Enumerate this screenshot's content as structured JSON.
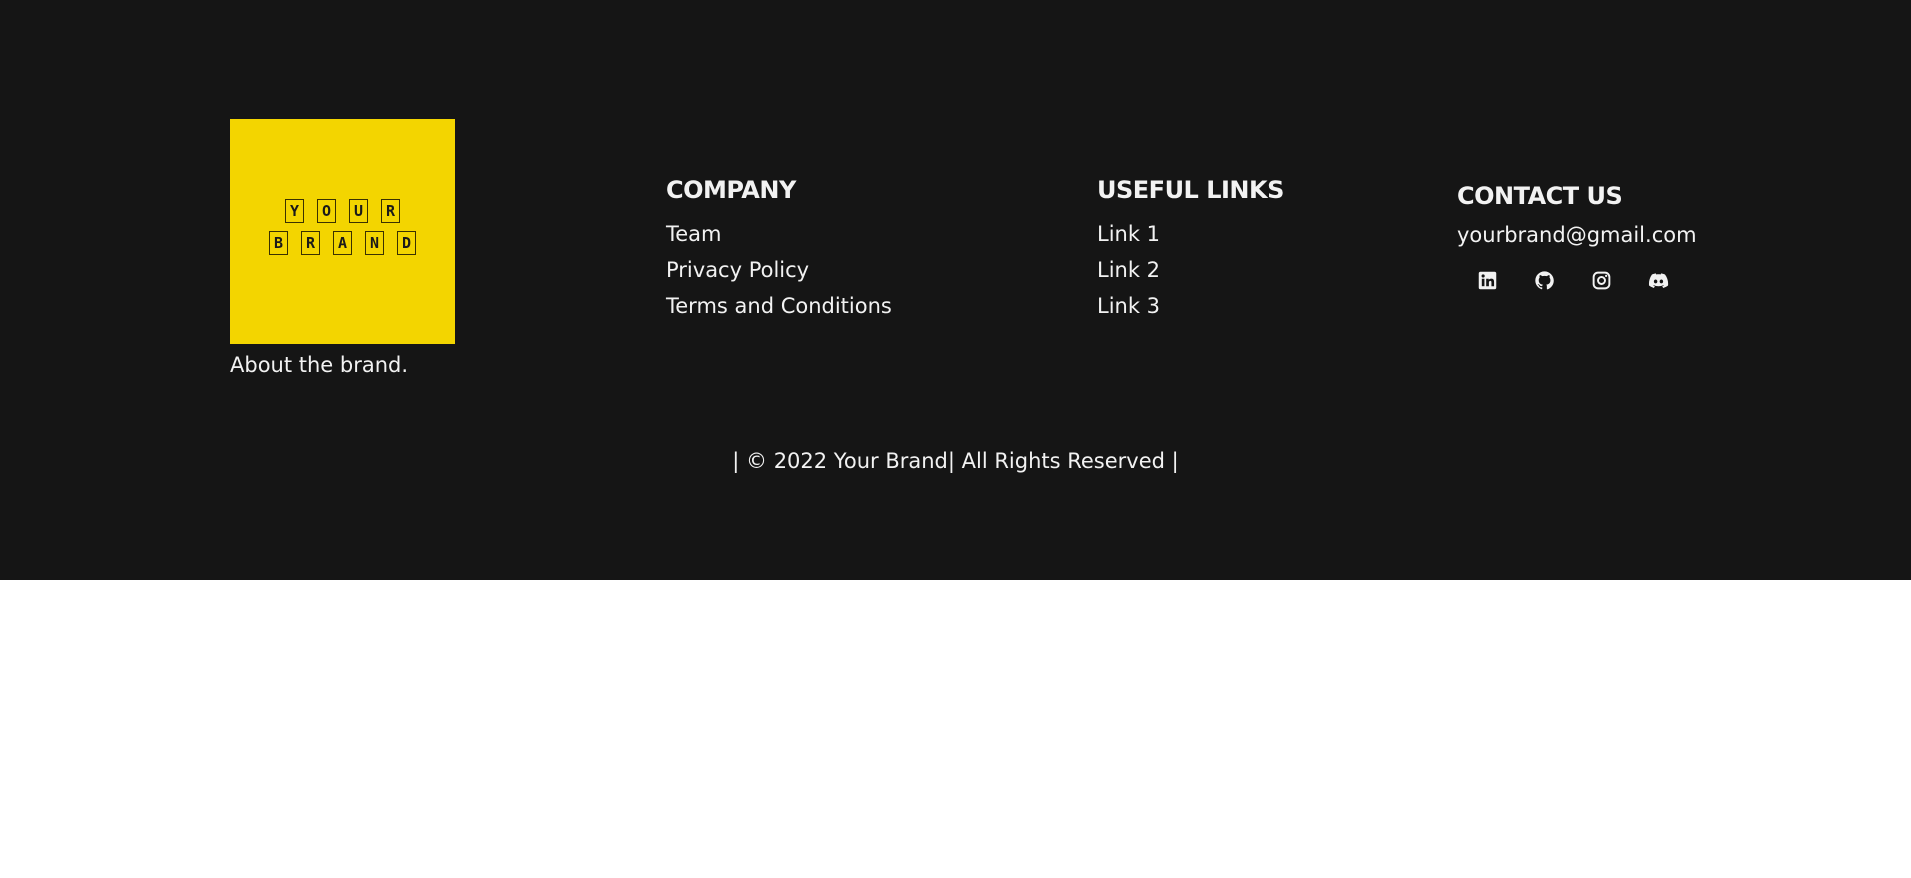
{
  "brand": {
    "logo_row1": [
      "Y",
      "O",
      "U",
      "R"
    ],
    "logo_row2": [
      "B",
      "R",
      "A",
      "N",
      "D"
    ],
    "about": "About the brand."
  },
  "company": {
    "title": "COMPANY",
    "links": [
      "Team",
      "Privacy Policy",
      "Terms and Conditions"
    ]
  },
  "useful_links": {
    "title": "USEFUL LINKS",
    "links": [
      "Link 1",
      "Link 2",
      "Link 3"
    ]
  },
  "contact": {
    "title": "CONTACT US",
    "email": "yourbrand@gmail.com",
    "socials": [
      "linkedin-icon",
      "github-icon",
      "instagram-icon",
      "discord-icon"
    ]
  },
  "copyright": "| © 2022 Your Brand| All Rights Reserved |",
  "colors": {
    "footer_bg": "#151515",
    "logo_bg": "#f3d500",
    "text": "#f2f2f2",
    "page_bg": "#ffffff"
  }
}
